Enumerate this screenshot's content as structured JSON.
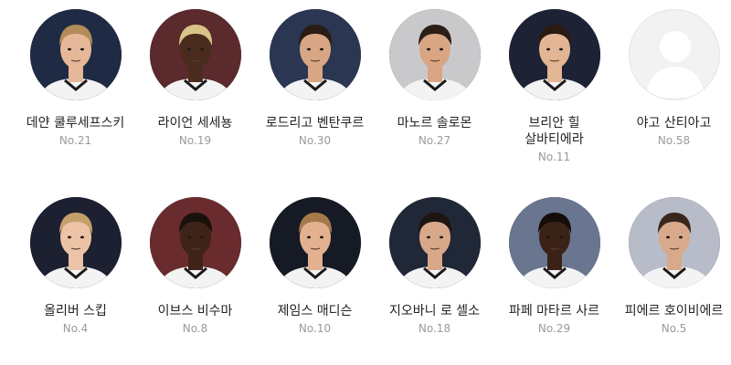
{
  "players": [
    {
      "name": "데얀 쿨루세프스키",
      "number": "No.21",
      "bg": "#1f2b44",
      "skin": "#e6b899",
      "hair": "#b48c5a"
    },
    {
      "name": "라이언 세세뇽",
      "number": "No.19",
      "bg": "#5a2a2c",
      "skin": "#4a2c1f",
      "hair": "#d9c48a"
    },
    {
      "name": "로드리고 벤탄쿠르",
      "number": "No.30",
      "bg": "#2a3652",
      "skin": "#d8a684",
      "hair": "#2a1d15"
    },
    {
      "name": "마노르 솔로몬",
      "number": "No.27",
      "bg": "#c9c9cc",
      "skin": "#d9a583",
      "hair": "#2b1e16"
    },
    {
      "name": "브리안 힐 살바티에라",
      "number": "No.11",
      "bg": "#1d2235",
      "skin": "#e2b595",
      "hair": "#2a1a12"
    },
    {
      "name": "야고 산티아고",
      "number": "No.58",
      "placeholder": true
    },
    {
      "name": "올리버 스킵",
      "number": "No.4",
      "bg": "#1c2030",
      "skin": "#ecc3a6",
      "hair": "#c6a06a"
    },
    {
      "name": "이브스 비수마",
      "number": "No.8",
      "bg": "#6a2b2e",
      "skin": "#3e2418",
      "hair": "#1a110c"
    },
    {
      "name": "제임스 매디슨",
      "number": "No.10",
      "bg": "#161a25",
      "skin": "#e3b190",
      "hair": "#a57a4b"
    },
    {
      "name": "지오바니 로 셀소",
      "number": "No.18",
      "bg": "#202736",
      "skin": "#d8a88a",
      "hair": "#1d150f"
    },
    {
      "name": "파페 마타르 사르",
      "number": "No.29",
      "bg": "#6a7590",
      "skin": "#3a2217",
      "hair": "#150d09"
    },
    {
      "name": "피에르 호이비에르",
      "number": "No.5",
      "bg": "#b7bcc8",
      "skin": "#d9a98c",
      "hair": "#3a271b"
    }
  ]
}
